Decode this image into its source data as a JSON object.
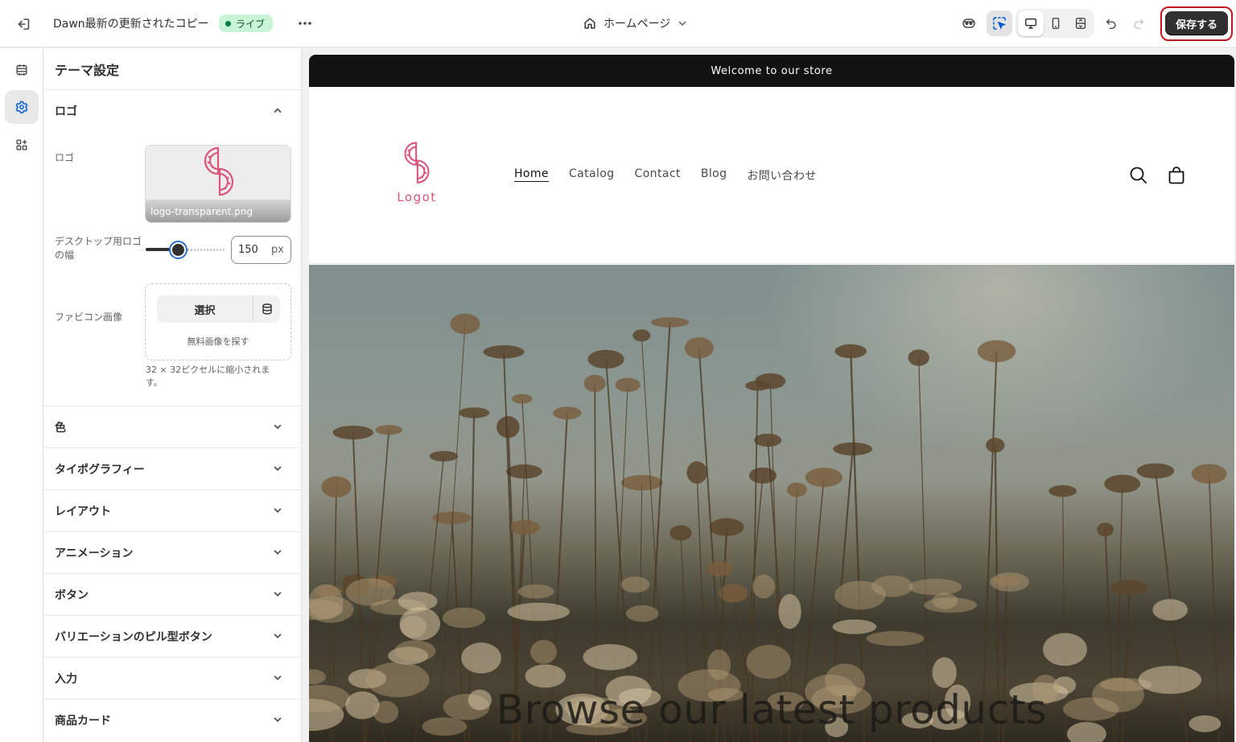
{
  "topbar": {
    "title": "Dawn最新の更新されたコピー",
    "status_badge": "ライブ",
    "page_selector": "ホームページ",
    "save_label": "保存する",
    "icons": [
      "exit-icon",
      "more-icon",
      "home-icon",
      "chevron-down-icon",
      "ai-assistant-icon",
      "inspector-icon",
      "desktop-icon",
      "mobile-icon",
      "fullscreen-icon",
      "undo-icon",
      "redo-icon"
    ]
  },
  "rail": {
    "items": [
      {
        "name": "sections",
        "icon": "sections-icon",
        "active": false
      },
      {
        "name": "theme-settings",
        "icon": "gear-icon",
        "active": true
      },
      {
        "name": "apps",
        "icon": "apps-icon",
        "active": false
      }
    ]
  },
  "panel": {
    "title": "テーマ設定",
    "logo_section": {
      "heading": "ロゴ",
      "logo_label": "ロゴ",
      "logo_filename": "logo-transparent.png",
      "width_label": "デスクトップ用ロゴの幅",
      "width_value": "150",
      "width_unit": "px",
      "width_slider_fraction": 0.4,
      "favicon_label": "ファビコン画像",
      "favicon_select": "選択",
      "favicon_free": "無料画像を探す",
      "favicon_help": "32 × 32ピクセルに縮小されます。"
    },
    "sections": [
      "色",
      "タイポグラフィー",
      "レイアウト",
      "アニメーション",
      "ボタン",
      "バリエーションのピル型ボタン",
      "入力",
      "商品カード"
    ]
  },
  "preview": {
    "announcement": "Welcome to our store",
    "logo_text": "Logot",
    "nav": [
      "Home",
      "Catalog",
      "Contact",
      "Blog",
      "お問い合わせ"
    ],
    "nav_current": "Home",
    "hero_heading": "Browse our latest products",
    "accent_color": "#d9557a"
  }
}
